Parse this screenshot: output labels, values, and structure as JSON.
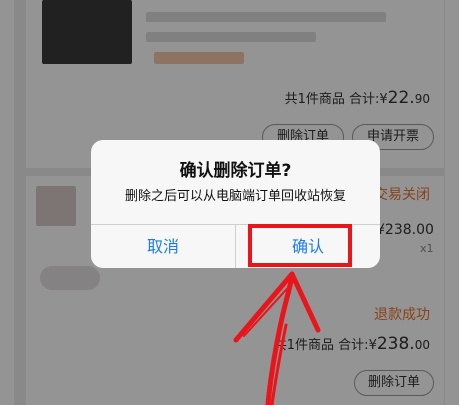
{
  "background_orders": {
    "order1": {
      "total_prefix": "共1件商品 合计:",
      "currency": "¥",
      "amount_int": "22.",
      "amount_dec": "90",
      "buttons": [
        "删除订单",
        "申请开票"
      ]
    },
    "order2": {
      "status": "交易关闭",
      "price": "¥238.00",
      "qty": "x1",
      "refund_status": "退款成功",
      "total_prefix": "共1件商品 合计:",
      "currency": "¥",
      "amount_int": "238.",
      "amount_dec": "00",
      "delete_button": "删除订单"
    }
  },
  "dialog": {
    "title": "确认删除订单?",
    "message": "删除之后可以从电脑端订单回收站恢复",
    "cancel_label": "取消",
    "confirm_label": "确认"
  },
  "colors": {
    "accent_blue": "#1a7cf0",
    "highlight_red": "#e8151b",
    "status_orange": "#e8742f"
  }
}
